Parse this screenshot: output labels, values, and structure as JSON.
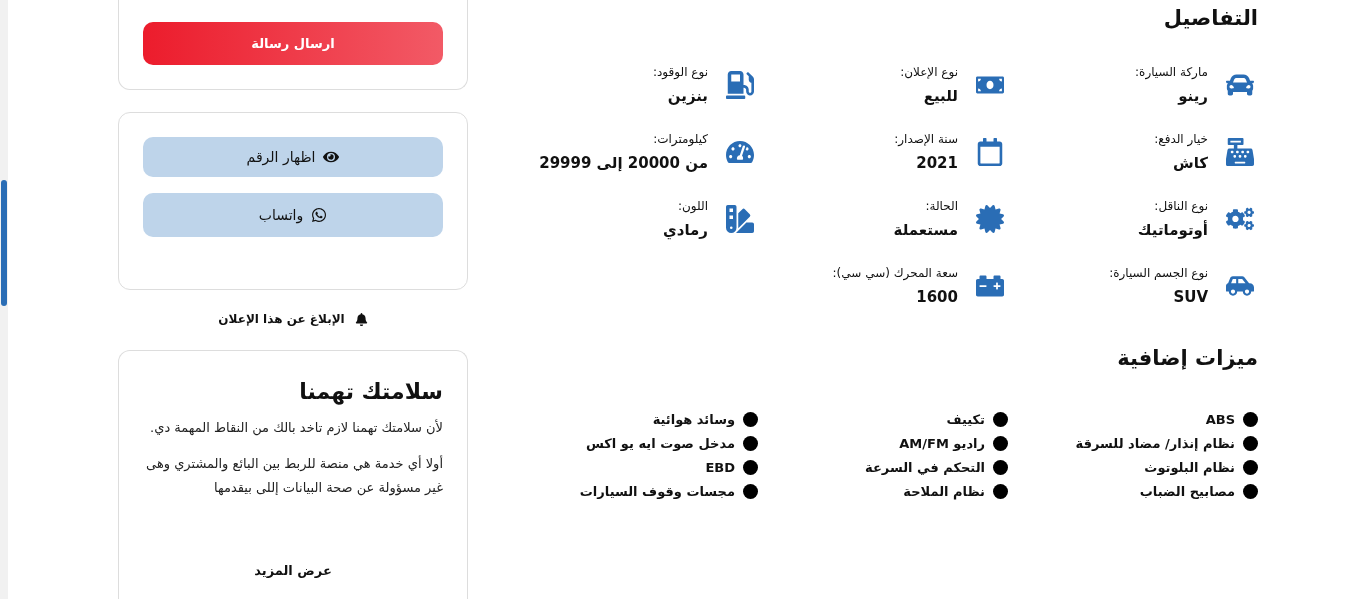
{
  "contact_card": {
    "send_button": "ارسال رسالة"
  },
  "phone_card": {
    "show_number_button": "اظهار الرقم",
    "whatsapp_button": "واتساب"
  },
  "report_link": "الإبلاغ عن هذا الإعلان",
  "safety_card": {
    "title": "سلامتك تهمنا",
    "paragraphs": [
      "لأن سلامتك تهمنا لازم تاخد بالك من النقاط المهمة دي.",
      "أولا أي خدمة هي منصة للربط بين البائع والمشتري وهى غير مسؤولة عن صحة البيانات إللى بيقدمها"
    ],
    "more_button": "عرض المزيد"
  },
  "details": {
    "title": "التفاصيل",
    "items": [
      {
        "label": "ماركة السيارة:",
        "value": "رينو"
      },
      {
        "label": "نوع الإعلان:",
        "value": "للبيع"
      },
      {
        "label": "نوع الوقود:",
        "value": "بنزين"
      },
      {
        "label": "خيار الدفع:",
        "value": "كاش"
      },
      {
        "label": "سنة الإصدار:",
        "value": "2021"
      },
      {
        "label": "كيلومترات:",
        "value": "من 20000 إلى 29999"
      },
      {
        "label": "نوع الناقل:",
        "value": "أوتوماتيك"
      },
      {
        "label": "الحالة:",
        "value": "مستعملة"
      },
      {
        "label": "اللون:",
        "value": "رمادي"
      },
      {
        "label": "نوع الجسم السيارة:",
        "value": "SUV"
      },
      {
        "label": "سعة المحرك (سي سي):",
        "value": "1600"
      }
    ]
  },
  "features": {
    "title": "ميزات إضافية",
    "items": [
      "ABS",
      "تكييف",
      "وسائد هوائية",
      "نظام إنذار/ مضاد للسرقة",
      "راديو AM/FM",
      "مدخل صوت ايه يو اكس",
      "نظام البلوتوث",
      "التحكم في السرعة",
      "EBD",
      "مصابيح الضباب",
      "نظام الملاحة",
      "مجسات وقوف السيارات"
    ]
  }
}
